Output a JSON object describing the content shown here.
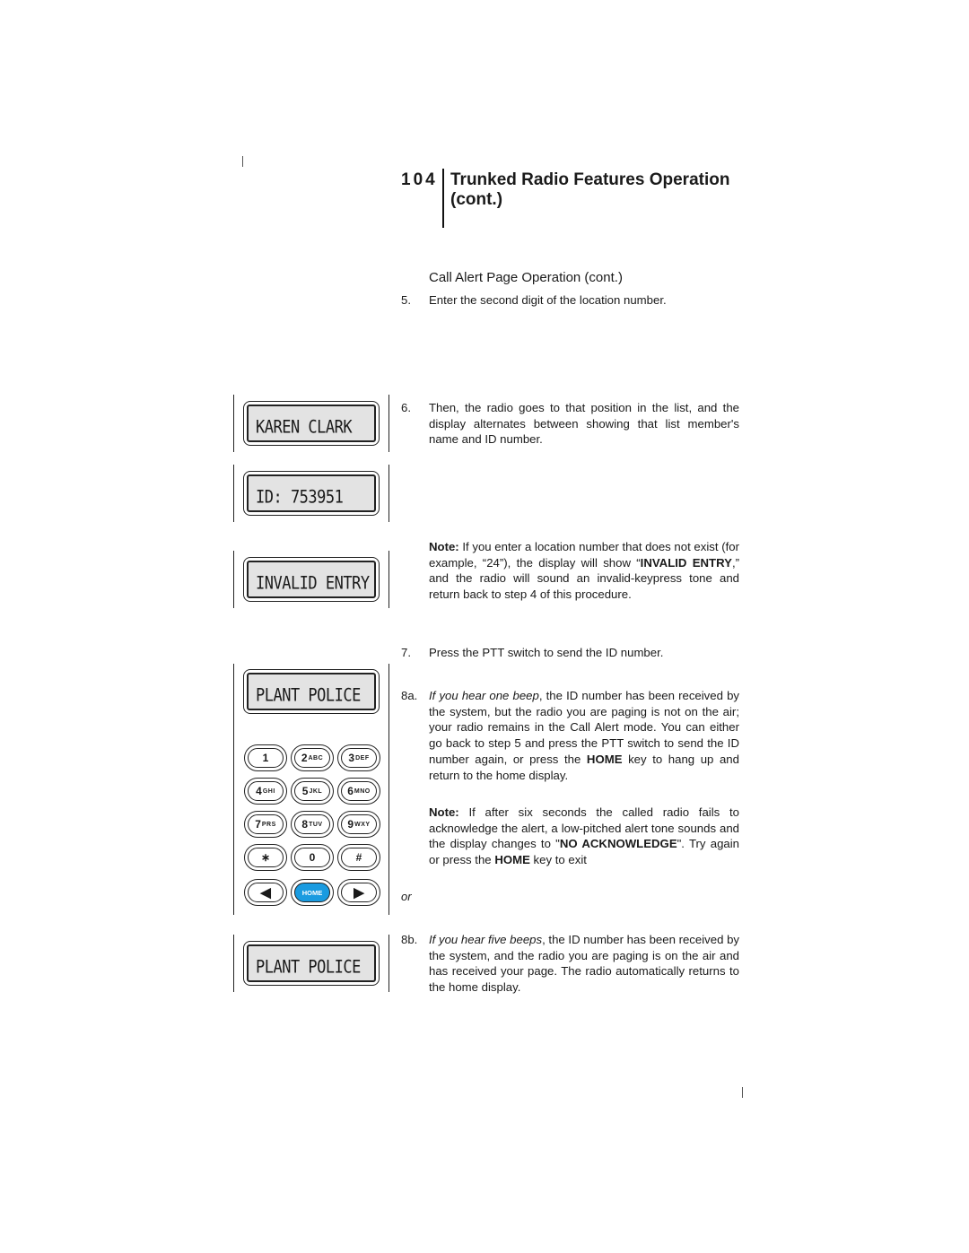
{
  "header": {
    "page_number": "104",
    "title": "Trunked Radio Features Operation (cont.)"
  },
  "section_title": "Call Alert Page Operation (cont.)",
  "steps": {
    "s5": {
      "num": "5.",
      "text": "Enter the second digit of the location number."
    },
    "s6": {
      "num": "6.",
      "text": "Then, the radio goes to that position in the list, and the display alternates between showing that list member's name and ID number."
    },
    "note1": {
      "label": "Note:",
      "pre": " If you enter a location number that does not exist  (for example, “24”), the display will show “",
      "bold": "INVALID ENTRY",
      "post": ",” and the radio will sound an invalid-keypress tone and return back to step 4 of this procedure."
    },
    "s7": {
      "num": "7.",
      "text": "Press the PTT switch to send the ID number."
    },
    "s8a": {
      "num": "8a.",
      "italic": "If you hear one beep",
      "pre": ", the ID number has been received by the system, but the radio you are paging is not on the air; your radio remains in the Call Alert mode. You can either go back to step 5 and press the PTT switch to send the ID number again, or press the ",
      "bold": "HOME",
      "post": " key to hang up and return to the home display."
    },
    "note2": {
      "label": "Note:",
      "pre": " If after six seconds the called radio fails to acknowledge the alert, a low-pitched alert tone sounds and the display changes to \"",
      "bold1": "NO ACKNOWLEDGE",
      "mid": "\". Try again or press the ",
      "bold2": "HOME",
      "post": " key to exit"
    },
    "or": "or",
    "s8b": {
      "num": "8b.",
      "italic": "If you hear five beeps",
      "post": ", the ID number has been received by the system, and the radio you are paging is on the air and has received your page. The radio automatically returns to the home display."
    }
  },
  "displays": {
    "d1": "KAREN CLARK",
    "d2": "ID: 753951",
    "d3": "INVALID ENTRY",
    "d4": "PLANT POLICE",
    "d5": "PLANT POLICE"
  },
  "keypad": {
    "keys": [
      {
        "digit": "1",
        "letters": ""
      },
      {
        "digit": "2",
        "letters": "ABC"
      },
      {
        "digit": "3",
        "letters": "DEF"
      },
      {
        "digit": "4",
        "letters": "GHI"
      },
      {
        "digit": "5",
        "letters": "JKL"
      },
      {
        "digit": "6",
        "letters": "MNO"
      },
      {
        "digit": "7",
        "letters": "PRS"
      },
      {
        "digit": "8",
        "letters": "TUV"
      },
      {
        "digit": "9",
        "letters": "WXY"
      },
      {
        "digit": "∗",
        "letters": ""
      },
      {
        "digit": "0",
        "letters": ""
      },
      {
        "digit": "#",
        "letters": ""
      }
    ],
    "left_arrow": "◀",
    "home": "HOME",
    "right_arrow": "▶",
    "home_color": "#1a9be0"
  }
}
